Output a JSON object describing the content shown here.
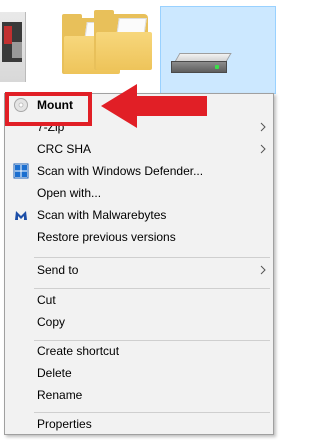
{
  "menu": {
    "items": [
      {
        "key": "mount",
        "label": "Mount",
        "bold": true,
        "icon": "disc-icon",
        "submenu": false
      },
      {
        "key": "7zip",
        "label": "7-Zip",
        "bold": false,
        "icon": null,
        "submenu": true
      },
      {
        "key": "crc",
        "label": "CRC SHA",
        "bold": false,
        "icon": null,
        "submenu": true
      },
      {
        "key": "defender",
        "label": "Scan with Windows Defender...",
        "bold": false,
        "icon": "windows-defender-icon",
        "submenu": false
      },
      {
        "key": "openwith",
        "label": "Open with...",
        "bold": false,
        "icon": null,
        "submenu": false
      },
      {
        "key": "malwarebytes",
        "label": "Scan with Malwarebytes",
        "bold": false,
        "icon": "malwarebytes-icon",
        "submenu": false
      },
      {
        "key": "restore",
        "label": "Restore previous versions",
        "bold": false,
        "icon": null,
        "submenu": false
      },
      {
        "key": "sendto",
        "label": "Send to",
        "bold": false,
        "icon": null,
        "submenu": true
      },
      {
        "key": "cut",
        "label": "Cut",
        "bold": false,
        "icon": null,
        "submenu": false
      },
      {
        "key": "copy",
        "label": "Copy",
        "bold": false,
        "icon": null,
        "submenu": false
      },
      {
        "key": "shortcut",
        "label": "Create shortcut",
        "bold": false,
        "icon": null,
        "submenu": false
      },
      {
        "key": "delete",
        "label": "Delete",
        "bold": false,
        "icon": null,
        "submenu": false
      },
      {
        "key": "rename",
        "label": "Rename",
        "bold": false,
        "icon": null,
        "submenu": false
      },
      {
        "key": "properties",
        "label": "Properties",
        "bold": false,
        "icon": null,
        "submenu": false
      }
    ]
  },
  "annotation": {
    "highlight_color": "#e11f26",
    "arrow_color": "#e11f26"
  },
  "colors": {
    "menu_bg": "#f2f2f2",
    "selection_bg": "#cce8ff",
    "folder": "#eec45a"
  }
}
